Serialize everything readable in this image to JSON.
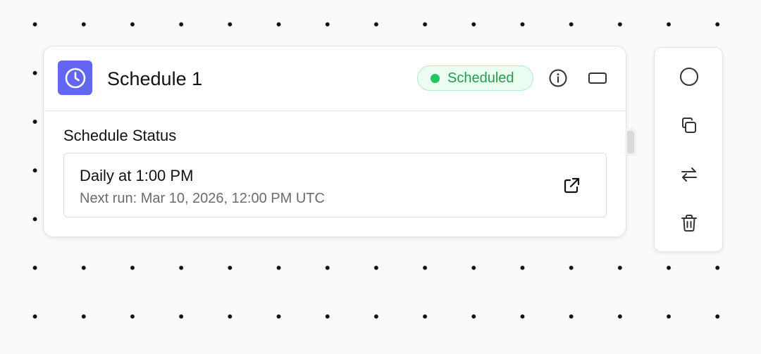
{
  "node": {
    "icon": "clock-icon",
    "title": "Schedule 1",
    "status": {
      "label": "Scheduled",
      "color": "#22c55e"
    },
    "header_actions": [
      "info-icon",
      "collapse-icon"
    ],
    "accent_color": "#6366f1"
  },
  "schedule_status": {
    "section_label": "Schedule Status",
    "frequency": "Daily at 1:00 PM",
    "next_run": "Next run: Mar 10, 2026, 12:00 PM UTC",
    "action_icon": "external-link-icon"
  },
  "toolbar": {
    "tools": [
      {
        "name": "circle-icon"
      },
      {
        "name": "duplicate-icon"
      },
      {
        "name": "swap-icon"
      },
      {
        "name": "trash-icon"
      }
    ]
  }
}
